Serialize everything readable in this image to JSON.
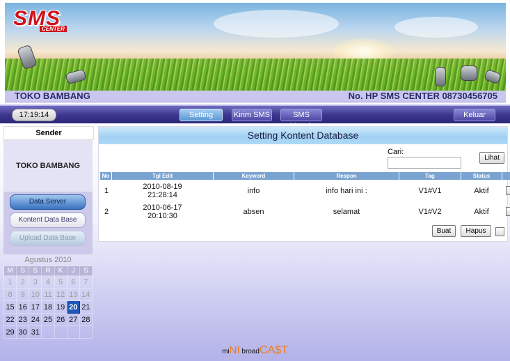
{
  "header": {
    "logo_main": "SMS",
    "logo_sub": "CENTER",
    "store_name": "TOKO BAMBANG",
    "hp_number": "No. HP SMS CENTER 08730456705"
  },
  "nav": {
    "clock": "17:19:14",
    "items": [
      {
        "label": "Setting",
        "active": true
      },
      {
        "label": "Kirim SMS",
        "active": false
      },
      {
        "label": "SMS Masuk",
        "active": false
      }
    ],
    "logout": "Keluar"
  },
  "sidebar": {
    "header": "Sender",
    "sender_name": "TOKO BAMBANG",
    "buttons": [
      "Data Server",
      "Kontent Data Base",
      "Upload Data Base"
    ]
  },
  "calendar": {
    "title": "Agustus 2010",
    "weekdays": [
      "M",
      "S",
      "S",
      "R",
      "K",
      "J",
      "S"
    ],
    "weeks": [
      [
        "1",
        "2",
        "3",
        "4",
        "5",
        "6",
        "7"
      ],
      [
        "8",
        "9",
        "10",
        "11",
        "12",
        "13",
        "14"
      ],
      [
        "15",
        "16",
        "17",
        "18",
        "19",
        "20",
        "21"
      ],
      [
        "22",
        "23",
        "24",
        "25",
        "26",
        "27",
        "28"
      ],
      [
        "29",
        "30",
        "31",
        "",
        "",
        "",
        ""
      ]
    ],
    "today": "20"
  },
  "main": {
    "title": "Setting Kontent Database",
    "search_label": "Cari:",
    "search_value": "",
    "view_button": "Lihat",
    "columns": [
      "No",
      "Tgl Edit",
      "Keyword",
      "Respon",
      "Tag",
      "Status"
    ],
    "rows": [
      {
        "no": "1",
        "date": "2010-08-19",
        "time": "21:28:14",
        "keyword": "info",
        "respon": "info hari ini :",
        "tag": "V1#V1",
        "status": "Aktif"
      },
      {
        "no": "2",
        "date": "2010-06-17",
        "time": "20:10:30",
        "keyword": "absen",
        "respon": "selamat",
        "tag": "V1#V2",
        "status": "Aktif"
      }
    ],
    "create_button": "Buat",
    "delete_button": "Hapus"
  },
  "footer": {
    "part1": "mi",
    "part2": "NI",
    "part3": " broad",
    "part4": "CA$T"
  },
  "colors": {
    "nav_bg": "#3c378e",
    "table_header": "#7aa3d2",
    "today_highlight": "#1e57b8",
    "logo_red": "#d0121b",
    "footer_orange": "#f07a1a"
  }
}
